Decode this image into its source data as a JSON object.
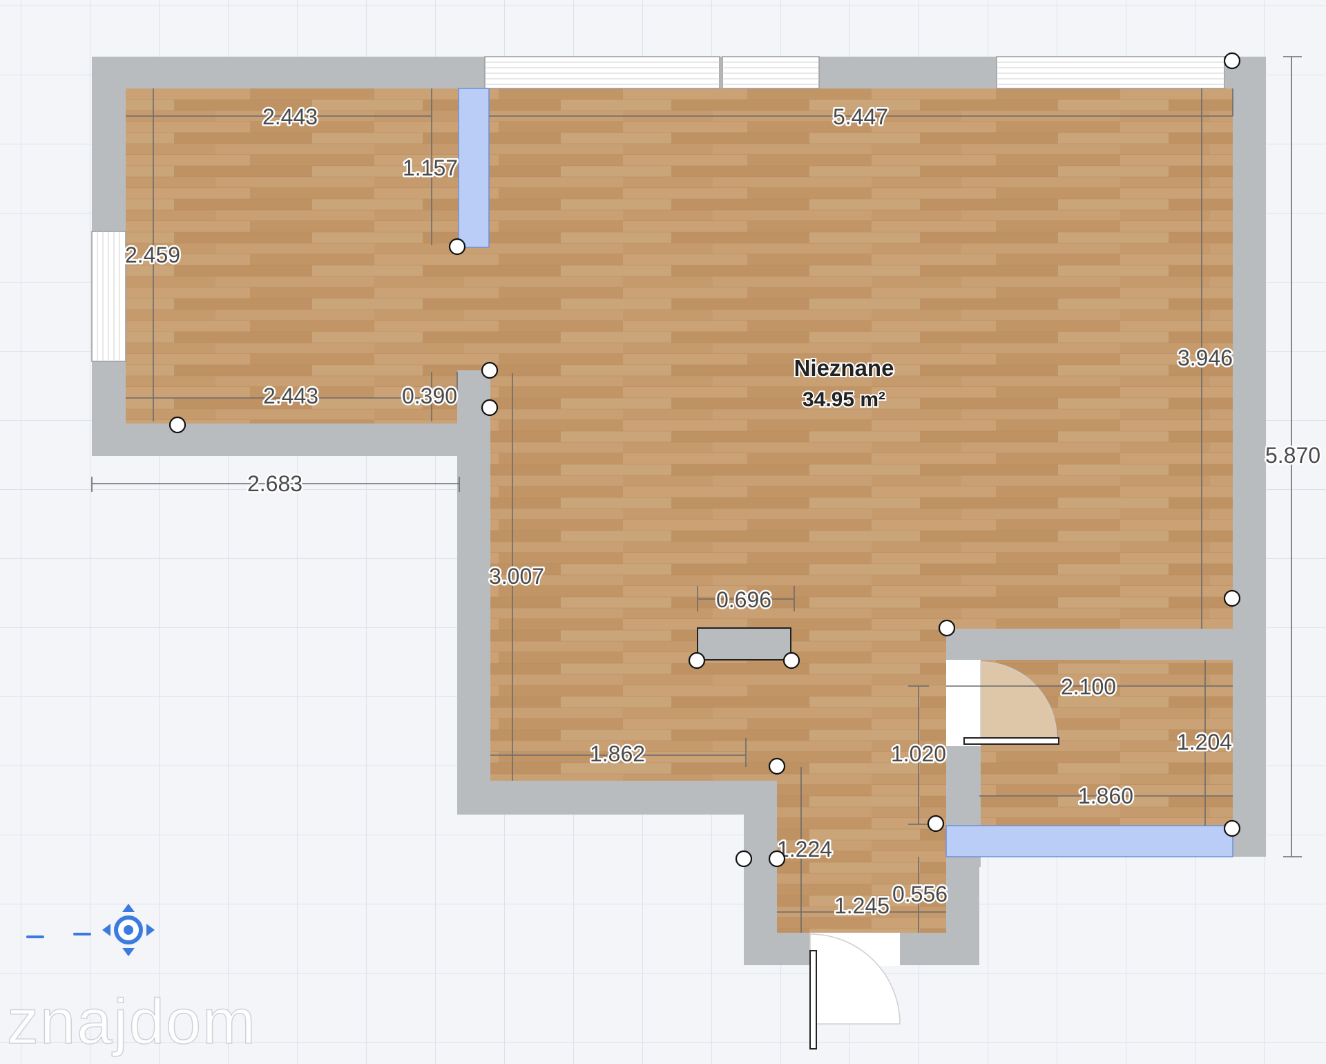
{
  "room": {
    "name": "Nieznane",
    "area": "34.95 m²"
  },
  "dimensions": {
    "top_left_width": "2.443",
    "top_right_width": "5.447",
    "partition_height": "1.157",
    "left_height": "2.459",
    "right_height": "3.946",
    "lower_left_width": "2.443",
    "step_width": "0.390",
    "outer_left_width": "2.683",
    "outer_height": "5.870",
    "inner_lower_height": "3.007",
    "island_width": "0.696",
    "bathroom_width_top": "2.100",
    "bathroom_height": "1.204",
    "bathroom_width_bottom": "1.860",
    "bottom_width": "1.862",
    "corridor_height": "1.020",
    "entry_height": "1.224",
    "entry_width": "1.245",
    "entry_side": "0.556"
  },
  "watermark": "znajdom",
  "colors": {
    "wall": "#b9bcbf",
    "floor": "#c49a6c",
    "glass": "#b9cdf7",
    "grid": "#dde2ea",
    "background": "#f3f5f9"
  },
  "icons": {
    "navigation": "pan-navigation-icon"
  }
}
